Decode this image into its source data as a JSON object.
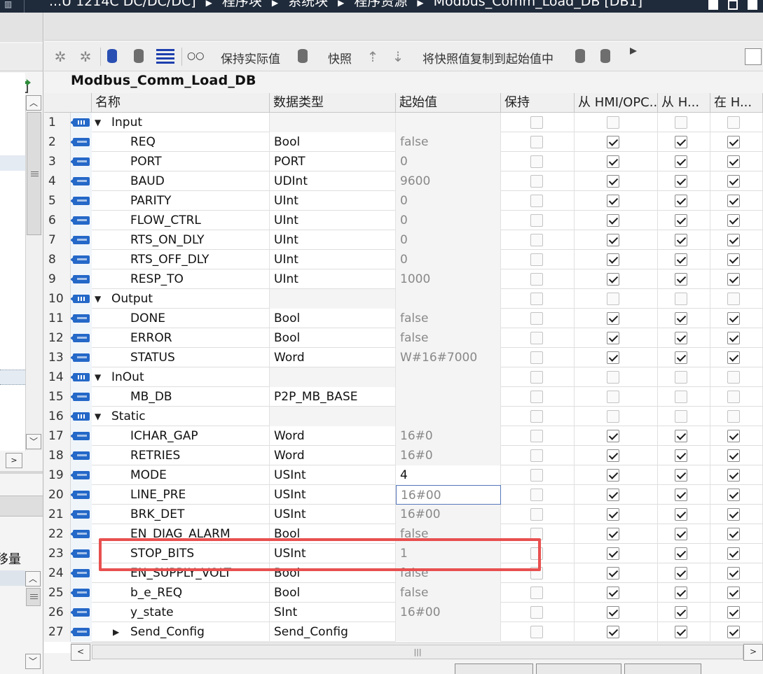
{
  "titlebar": {
    "crumbs": [
      "...U 1214C DC/DC/DC]",
      "程序块",
      "系统块",
      "程序资源",
      "Modbus_Comm_Load_DB [DB1]"
    ]
  },
  "left_panel": {
    "label": "移量"
  },
  "toolbar": {
    "keep_actual_label": "保持实际值",
    "snapshot_label": "快照",
    "copy_snapshot_label": "将快照值复制到起始值中"
  },
  "block": {
    "title": "Modbus_Comm_Load_DB"
  },
  "grid": {
    "columns": {
      "name": "名称",
      "type": "数据类型",
      "start": "起始值",
      "retain": "保持",
      "hmi_opc": "从 HMI/OPC...",
      "from_h": "从 H...",
      "in_h": "在 H..."
    },
    "rows": [
      {
        "num": "1",
        "name": "Input",
        "type": "",
        "start": "",
        "section": true,
        "retain": false,
        "hmi": false,
        "from_h": false,
        "in_h": false
      },
      {
        "num": "2",
        "name": "REQ",
        "type": "Bool",
        "start": "false",
        "section": false,
        "retain": false,
        "hmi": true,
        "from_h": true,
        "in_h": true
      },
      {
        "num": "3",
        "name": "PORT",
        "type": "PORT",
        "start": "0",
        "section": false,
        "retain": false,
        "hmi": true,
        "from_h": true,
        "in_h": true
      },
      {
        "num": "4",
        "name": "BAUD",
        "type": "UDInt",
        "start": "9600",
        "section": false,
        "retain": false,
        "hmi": true,
        "from_h": true,
        "in_h": true
      },
      {
        "num": "5",
        "name": "PARITY",
        "type": "UInt",
        "start": "0",
        "section": false,
        "retain": false,
        "hmi": true,
        "from_h": true,
        "in_h": true
      },
      {
        "num": "6",
        "name": "FLOW_CTRL",
        "type": "UInt",
        "start": "0",
        "section": false,
        "retain": false,
        "hmi": true,
        "from_h": true,
        "in_h": true
      },
      {
        "num": "7",
        "name": "RTS_ON_DLY",
        "type": "UInt",
        "start": "0",
        "section": false,
        "retain": false,
        "hmi": true,
        "from_h": true,
        "in_h": true
      },
      {
        "num": "8",
        "name": "RTS_OFF_DLY",
        "type": "UInt",
        "start": "0",
        "section": false,
        "retain": false,
        "hmi": true,
        "from_h": true,
        "in_h": true
      },
      {
        "num": "9",
        "name": "RESP_TO",
        "type": "UInt",
        "start": "1000",
        "section": false,
        "retain": false,
        "hmi": true,
        "from_h": true,
        "in_h": true
      },
      {
        "num": "10",
        "name": "Output",
        "type": "",
        "start": "",
        "section": true,
        "retain": false,
        "hmi": false,
        "from_h": false,
        "in_h": false
      },
      {
        "num": "11",
        "name": "DONE",
        "type": "Bool",
        "start": "false",
        "section": false,
        "retain": false,
        "hmi": true,
        "from_h": true,
        "in_h": true
      },
      {
        "num": "12",
        "name": "ERROR",
        "type": "Bool",
        "start": "false",
        "section": false,
        "retain": false,
        "hmi": true,
        "from_h": true,
        "in_h": true
      },
      {
        "num": "13",
        "name": "STATUS",
        "type": "Word",
        "start": "W#16#7000",
        "section": false,
        "retain": false,
        "hmi": true,
        "from_h": true,
        "in_h": true
      },
      {
        "num": "14",
        "name": "InOut",
        "type": "",
        "start": "",
        "section": true,
        "retain": false,
        "hmi": false,
        "from_h": false,
        "in_h": false
      },
      {
        "num": "15",
        "name": "MB_DB",
        "type": "P2P_MB_BASE",
        "start": "",
        "section": false,
        "retain": false,
        "hmi": false,
        "from_h": false,
        "in_h": false
      },
      {
        "num": "16",
        "name": "Static",
        "type": "",
        "start": "",
        "section": true,
        "retain": false,
        "hmi": false,
        "from_h": false,
        "in_h": false
      },
      {
        "num": "17",
        "name": "ICHAR_GAP",
        "type": "Word",
        "start": "16#0",
        "section": false,
        "retain": false,
        "hmi": true,
        "from_h": true,
        "in_h": true
      },
      {
        "num": "18",
        "name": "RETRIES",
        "type": "Word",
        "start": "16#0",
        "section": false,
        "retain": false,
        "hmi": true,
        "from_h": true,
        "in_h": true
      },
      {
        "num": "19",
        "name": "MODE",
        "type": "USInt",
        "start": "4",
        "section": false,
        "retain": false,
        "hmi": true,
        "from_h": true,
        "in_h": true,
        "edited": true
      },
      {
        "num": "20",
        "name": "LINE_PRE",
        "type": "USInt",
        "start": "16#00",
        "section": false,
        "retain": false,
        "hmi": true,
        "from_h": true,
        "in_h": true,
        "focused": true
      },
      {
        "num": "21",
        "name": "BRK_DET",
        "type": "USInt",
        "start": "16#00",
        "section": false,
        "retain": false,
        "hmi": true,
        "from_h": true,
        "in_h": true
      },
      {
        "num": "22",
        "name": "EN_DIAG_ALARM",
        "type": "Bool",
        "start": "false",
        "section": false,
        "retain": false,
        "hmi": true,
        "from_h": true,
        "in_h": true
      },
      {
        "num": "23",
        "name": "STOP_BITS",
        "type": "USInt",
        "start": "1",
        "section": false,
        "retain": false,
        "hmi": true,
        "from_h": true,
        "in_h": true
      },
      {
        "num": "24",
        "name": "EN_SUPPLY_VOLT",
        "type": "Bool",
        "start": "false",
        "section": false,
        "retain": false,
        "hmi": true,
        "from_h": true,
        "in_h": true
      },
      {
        "num": "25",
        "name": "b_e_REQ",
        "type": "Bool",
        "start": "false",
        "section": false,
        "retain": false,
        "hmi": true,
        "from_h": true,
        "in_h": true
      },
      {
        "num": "26",
        "name": "y_state",
        "type": "SInt",
        "start": "16#00",
        "section": false,
        "retain": false,
        "hmi": true,
        "from_h": true,
        "in_h": true
      },
      {
        "num": "27",
        "name": "Send_Config",
        "type": "Send_Config",
        "start": "",
        "section": false,
        "collapsed": true,
        "retain": false,
        "hmi": true,
        "from_h": true,
        "in_h": true
      }
    ]
  },
  "colors": {
    "highlight_box": "#e8504f",
    "pin_blue": "#2468c8"
  }
}
